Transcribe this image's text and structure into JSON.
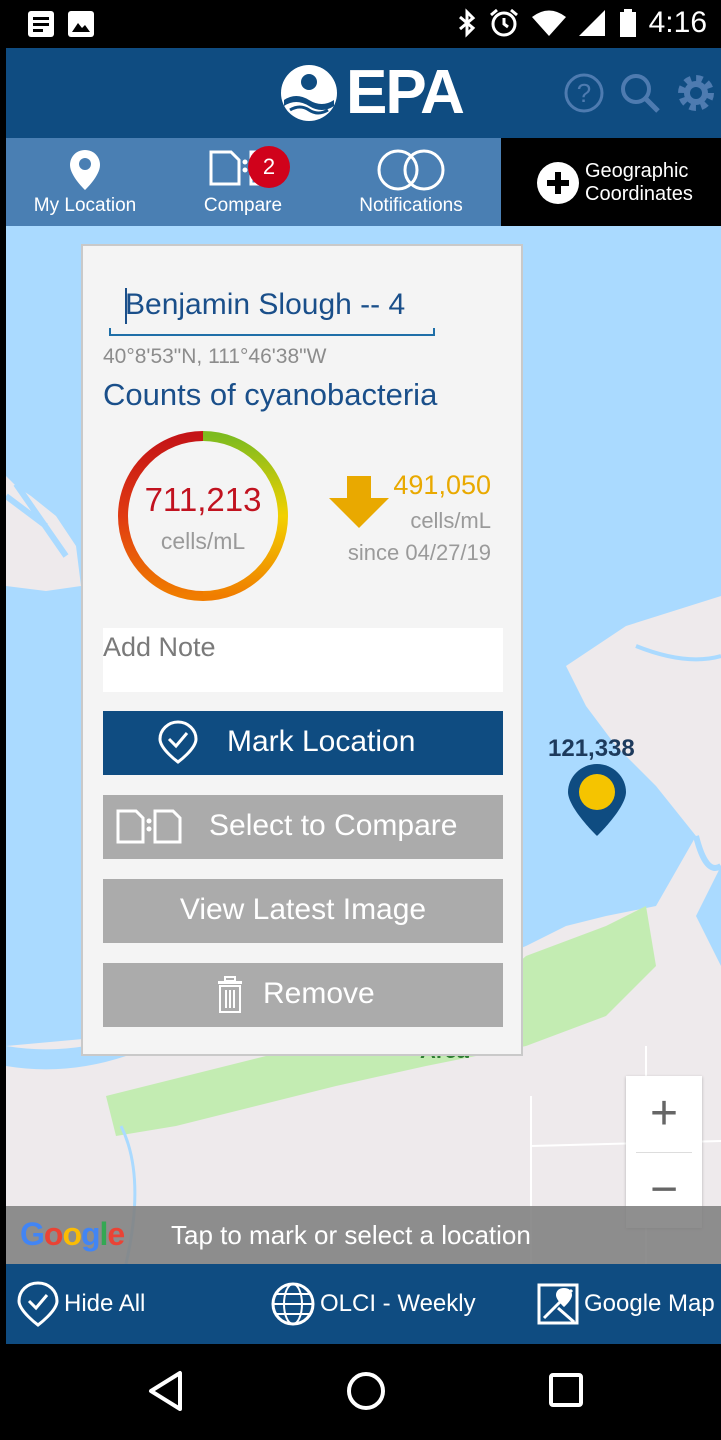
{
  "status_bar": {
    "time": "4:16"
  },
  "header": {
    "logo_text": "EPA"
  },
  "tabs": {
    "my_location": "My Location",
    "compare": "Compare",
    "compare_badge": "2",
    "notifications": "Notifications",
    "geographic_line1": "Geographic",
    "geographic_line2": "Coordinates"
  },
  "panel": {
    "location_name": "Benjamin Slough -- 4",
    "coordinates": "40°8'53\"N, 111°46'38\"W",
    "metric_title": "Counts of cyanobacteria",
    "current_value": "711,213",
    "current_unit": "cells/mL",
    "change_value": "491,050",
    "change_unit": "cells/mL",
    "change_since": "since 04/27/19",
    "note_placeholder": "Add Note",
    "mark_location": "Mark Location",
    "select_compare": "Select to Compare",
    "view_latest": "View Latest Image",
    "remove": "Remove"
  },
  "map": {
    "pin_value": "121,338",
    "area_label": "Area",
    "zoom_in": "+",
    "zoom_out": "−",
    "attribution": "Google",
    "hint": "Tap to mark or select a location"
  },
  "bottom_bar": {
    "hide_all": "Hide All",
    "layer": "OLCI - Weekly",
    "map_type": "Google Map"
  },
  "colors": {
    "brand_blue": "#0f4c81",
    "tab_blue": "#4a7fb3",
    "badge_red": "#d0021b",
    "water": "#aadaff",
    "land": "#eeeaec",
    "park": "#c3ecb2",
    "value_red": "#c1121f",
    "change_yellow": "#e9a900",
    "button_gray": "#ababab"
  },
  "icons": {
    "status_left": [
      "news-icon",
      "image-icon"
    ],
    "status_right": [
      "bluetooth-icon",
      "alarm-icon",
      "wifi-icon",
      "signal-icon",
      "battery-icon"
    ],
    "header": [
      "help-icon",
      "search-icon",
      "gear-icon"
    ],
    "nav": [
      "back-icon",
      "home-icon",
      "recents-icon"
    ]
  }
}
